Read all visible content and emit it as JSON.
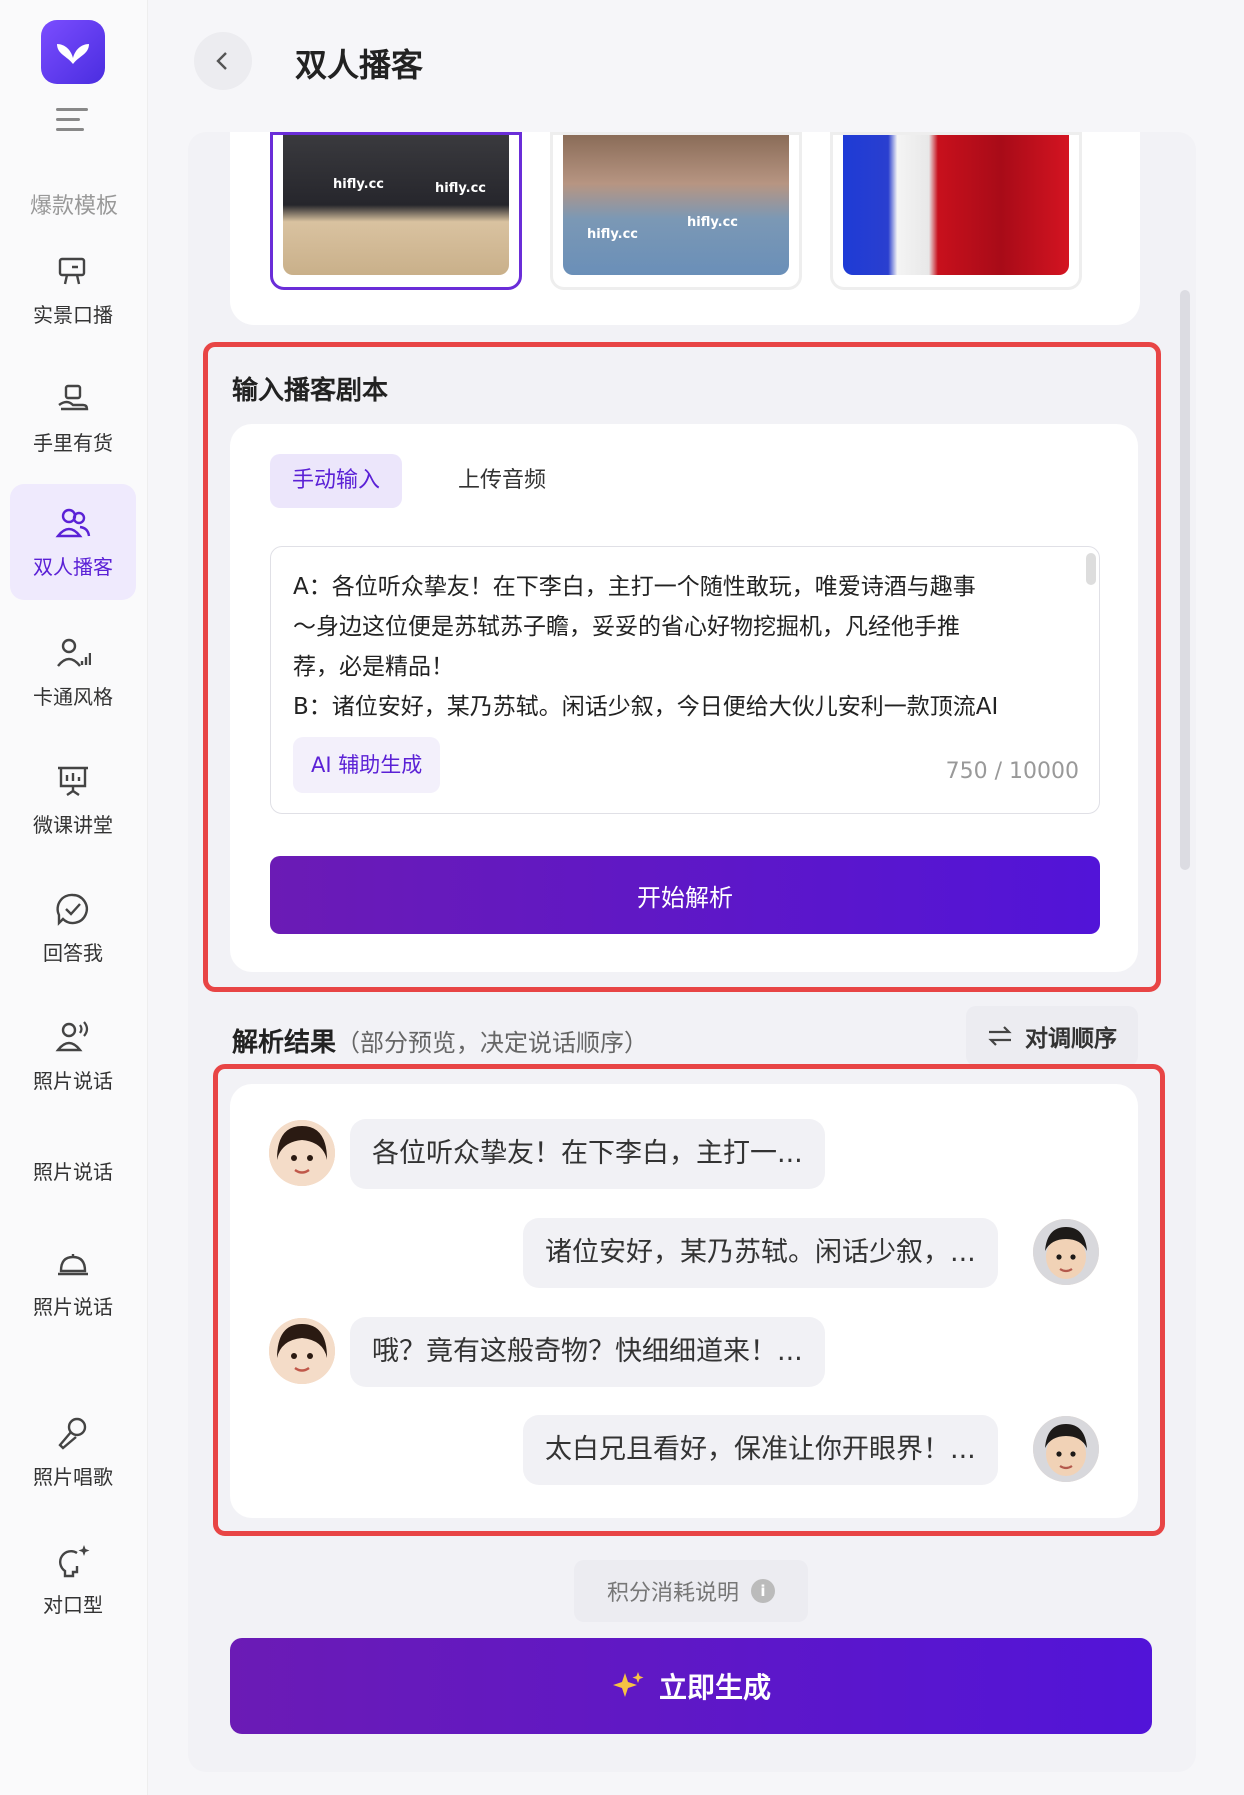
{
  "sidebar": {
    "section_label": "爆款模板",
    "items": [
      {
        "label": "实景口播",
        "icon": "presenter-board-icon"
      },
      {
        "label": "手里有货",
        "icon": "hand-product-icon"
      },
      {
        "label": "双人播客",
        "icon": "two-users-icon"
      },
      {
        "label": "卡通风格",
        "icon": "user-signal-icon"
      },
      {
        "label": "微课讲堂",
        "icon": "presentation-screen-icon"
      },
      {
        "label": "回答我",
        "icon": "check-chat-icon"
      },
      {
        "label": "照片说话",
        "icon": "user-speaking-icon"
      },
      {
        "label": "照片说话",
        "icon": "none"
      },
      {
        "label": "照片说话",
        "icon": "bell-tray-icon"
      },
      {
        "label": "照片唱歌",
        "icon": "microphone-icon"
      },
      {
        "label": "对口型",
        "icon": "lip-sync-icon"
      }
    ]
  },
  "header": {
    "title": "双人播客"
  },
  "thumbnails": {
    "brand_text": "hifly.cc",
    "selected_index": 0
  },
  "script_section": {
    "title": "输入播客剧本",
    "tabs": [
      "手动输入",
      "上传音频"
    ],
    "lines": [
      "A：各位听众挚友！在下李白，主打一个随性敢玩，唯爱诗酒与趣事",
      "～身边这位便是苏轼苏子瞻，妥妥的省心好物挖掘机，凡经他手推",
      "荐，必是精品！",
      "B：诸位安好，某乃苏轼。闲话少叙，今日便给大伙儿安利一款顶流AI"
    ],
    "ai_button": "AI 辅助生成",
    "counter": "750 / 10000",
    "parse_button": "开始解析"
  },
  "result_section": {
    "title": "解析结果",
    "subtitle": "（部分预览，决定说话顺序）",
    "swap_button": "对调顺序",
    "dialogue": [
      {
        "speaker": "A",
        "text": "各位听众挚友！在下李白，主打一..."
      },
      {
        "speaker": "B",
        "text": "诸位安好，某乃苏轼。闲话少叙，..."
      },
      {
        "speaker": "A",
        "text": "哦？竟有这般奇物？快细细道来！..."
      },
      {
        "speaker": "B",
        "text": "太白兄且看好，保准让你开眼界！..."
      }
    ]
  },
  "footer": {
    "credit_label": "积分消耗说明",
    "info_icon_text": "i",
    "generate_button": "立即生成",
    "generate_icon": "sparkle-icon"
  },
  "colors": {
    "accent": "#5b21d6",
    "highlight_frame": "#e84545"
  }
}
